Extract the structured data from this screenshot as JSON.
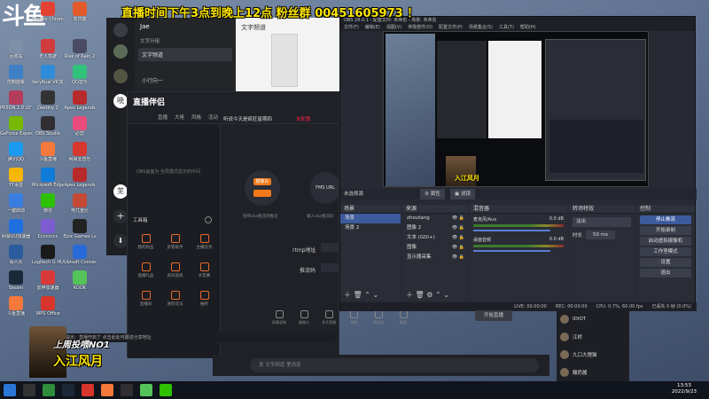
{
  "banner": "直播时间下午3点到晚上12点 粉丝群 00451605973 ！",
  "logo": "斗鱼",
  "desktop_icons": [
    {
      "label": "Jae",
      "color": "#3a6ab0"
    },
    {
      "label": "Google Chrome",
      "color": "#e34133"
    },
    {
      "label": "向日葵",
      "color": "#e25a2a"
    },
    {
      "label": "回收站",
      "color": "#7e8fa8"
    },
    {
      "label": "无人驾驶",
      "color": "#d13b3b"
    },
    {
      "label": "Risk of Rain 2",
      "color": "#4a4a64"
    },
    {
      "label": "控制面板",
      "color": "#3e7fc6"
    },
    {
      "label": "VeryKuai VK加速器",
      "color": "#2f8cd8"
    },
    {
      "label": "QQ音乐",
      "color": "#31c27c"
    },
    {
      "label": "PR5ON 2.0 10T打造修改",
      "color": "#b33b5b"
    },
    {
      "label": "Destiny 2",
      "color": "#333333"
    },
    {
      "label": "Apex Legends",
      "color": "#b72a2a"
    },
    {
      "label": "GeForce Experience",
      "color": "#76b900"
    },
    {
      "label": "OBS Studio",
      "color": "#302e31"
    },
    {
      "label": "必剪",
      "color": "#e94c7c"
    },
    {
      "label": "腾讯QQ",
      "color": "#1a9bf0"
    },
    {
      "label": "斗鱼直播",
      "color": "#f5793a"
    },
    {
      "label": "网易云音乐",
      "color": "#d6382f"
    },
    {
      "label": "YY语音",
      "color": "#f7b60a"
    },
    {
      "label": "Microsoft Edge",
      "color": "#0f7bd9"
    },
    {
      "label": "Apex Legends",
      "color": "#b72a2a"
    },
    {
      "label": "一键启动",
      "color": "#3a7de0"
    },
    {
      "label": "微信",
      "color": "#2dc100"
    },
    {
      "label": "电兀重比",
      "color": "#c44a35"
    },
    {
      "label": "网易UU加速器",
      "color": "#1f6fe0"
    },
    {
      "label": "Cccccccc",
      "color": "#7c5cd0"
    },
    {
      "label": "Epic Games Launcher",
      "color": "#222222"
    },
    {
      "label": "毒六大",
      "color": "#2b5d9e"
    },
    {
      "label": "Logitech G HUB",
      "color": "#1a1a1a"
    },
    {
      "label": "Ubisoft Connect",
      "color": "#2a6ad8"
    },
    {
      "label": "Steam",
      "color": "#1b2838"
    },
    {
      "label": "雷神加速器",
      "color": "#d83a3a"
    },
    {
      "label": "KOOK",
      "color": "#54c45a"
    },
    {
      "label": "斗鱼直播",
      "color": "#f5793a"
    },
    {
      "label": "WPS Office",
      "color": "#d8362c"
    }
  ],
  "chat_app": {
    "contact": "Jae",
    "group_label": "文字分组",
    "channel": "文字频道",
    "chat_title": "文字频道",
    "preview": "小行向一"
  },
  "zbj": {
    "title": "直播伴侣",
    "tabs": [
      "直播",
      "大佬",
      "风格",
      "活动"
    ],
    "stream_title": "听说今天是疯狂星期四",
    "tag": "未配置",
    "left_text": "OBS画面为 全局模式显示的中间",
    "node_left": "摄像头",
    "node_right": "FMS URL",
    "connect_label": "接到obs推流到推流",
    "right_hint": "输入obs推流码",
    "tools_header": "工具箱",
    "tools": [
      "我的粉丝",
      "房管助手",
      "主播任务",
      "直播礼品",
      "房间道具",
      "水友赛",
      "直播间",
      "进阶玩法",
      "抽奖"
    ],
    "rtmp_label": "rtmp地址",
    "key_label": "推流码",
    "bottom_tools": [
      "屏幕录制",
      "摄像头",
      "多开直播",
      "录制",
      "麦克风",
      "截图"
    ],
    "start_btn": "开始直播",
    "chat_input": "发 文字频道 里消息",
    "chat_system": "系统提示：直播开启了 点击此处可跟进分享地址"
  },
  "obs": {
    "window_title": "OBS 28.0.1 - 配置文件: 未命名 - 场景: 未命名",
    "menu": [
      "文件(F)",
      "编辑(E)",
      "视图(V)",
      "停靠部件(D)",
      "配置文件(P)",
      "场景集合(S)",
      "工具(T)",
      "帮助(H)"
    ],
    "preview_label": "入江风月",
    "source_bar": "未选择源",
    "prop_btn": "属性",
    "filter_btn": "滤镜",
    "docks": {
      "scenes": {
        "title": "场景",
        "items": [
          "场景",
          "场景 2"
        ]
      },
      "sources": {
        "title": "来源",
        "items": [
          "zhoutang",
          "图像 2",
          "文本 (GDI+)",
          "图像",
          "显示器采集"
        ]
      },
      "mixer": {
        "title": "混音器",
        "tracks": [
          {
            "name": "麦克风/Aux",
            "db": "0.0 dB"
          },
          {
            "name": "桌面音频",
            "db": "0.0 dB"
          }
        ]
      },
      "transitions": {
        "title": "转场特效",
        "type": "淡出",
        "duration_label": "时长",
        "duration": "50 ms"
      },
      "controls": {
        "title": "控制",
        "buttons": [
          "停止推流",
          "开始录制",
          "启动虚拟摄像机",
          "工作室模式",
          "设置",
          "退出"
        ]
      }
    },
    "status": {
      "live": "LIVE: 00:00:00",
      "rec": "REC: 00:00:00",
      "cpu": "CPU: 0.7%, 60.00 fps",
      "frames": "已丢失 0 帧 (0.0%)"
    }
  },
  "danmaku_users": [
    "IDIOT",
    "江桥",
    "九口大狸猫",
    "酸奶酱"
  ],
  "overlay": {
    "line1": "上周投喂NO1",
    "line2": "入江风月"
  },
  "clock": {
    "time": "13:53",
    "date": "2022/9/23"
  }
}
